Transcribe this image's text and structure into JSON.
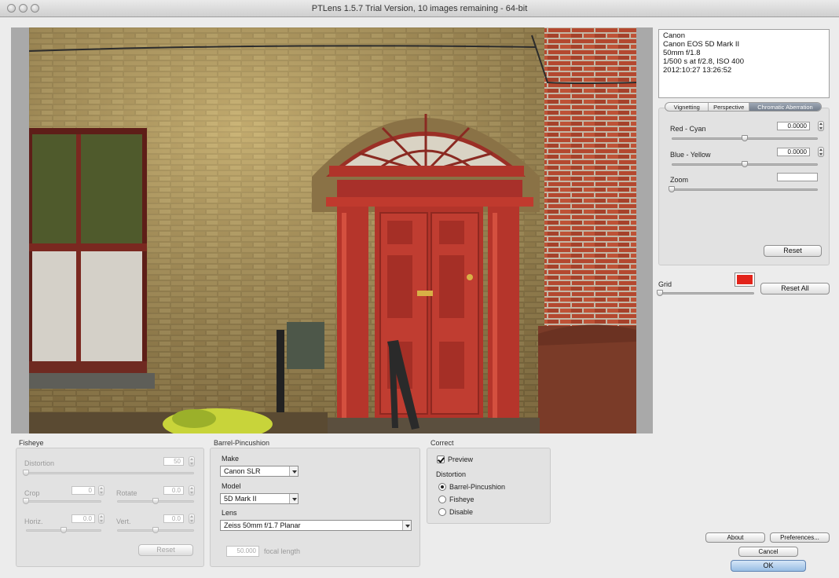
{
  "window": {
    "title": "PTLens 1.5.7 Trial Version, 10 images remaining - 64-bit"
  },
  "exif": {
    "lines": [
      "Canon",
      "Canon EOS 5D Mark II",
      "50mm f/1.8",
      "1/500 s at f/2.8, ISO 400",
      "2012:10:27 13:26:52"
    ]
  },
  "tabs": {
    "vignetting": "Vignetting",
    "perspective": "Perspective",
    "chromatic": "Chromatic Aberration"
  },
  "chromatic_panel": {
    "red_cyan": {
      "label": "Red - Cyan",
      "value": "0.0000",
      "level": 0.5
    },
    "blue_yellow": {
      "label": "Blue - Yellow",
      "value": "0.0000",
      "level": 0.5
    },
    "zoom": {
      "label": "Zoom",
      "value": "",
      "level": 0.0
    },
    "reset": "Reset"
  },
  "grid": {
    "label": "Grid",
    "level": 0.0,
    "color": "#e2231a"
  },
  "reset_all": "Reset All",
  "fisheye": {
    "heading": "Fisheye",
    "distortion": {
      "label": "Distortion",
      "value": "50",
      "level": 0.0
    },
    "crop": {
      "label": "Crop",
      "value": "0",
      "level": 0.0
    },
    "rotate": {
      "label": "Rotate",
      "value": "0.0",
      "level": 0.5
    },
    "horiz": {
      "label": "Horiz.",
      "value": "0.0",
      "level": 0.5
    },
    "vert": {
      "label": "Vert.",
      "value": "0.0",
      "level": 0.5
    },
    "reset": "Reset"
  },
  "barrel": {
    "heading": "Barrel-Pincushion",
    "make_label": "Make",
    "make_value": "Canon SLR",
    "model_label": "Model",
    "model_value": "5D Mark II",
    "lens_label": "Lens",
    "lens_value": "Zeiss 50mm f/1.7 Planar",
    "focal_value": "50.000",
    "focal_label": "focal length"
  },
  "correct": {
    "heading": "Correct",
    "preview": "Preview",
    "distortion_label": "Distortion",
    "options": [
      "Barrel-Pincushion",
      "Fisheye",
      "Disable"
    ],
    "selected": "Barrel-Pincushion"
  },
  "buttons": {
    "about": "About",
    "preferences": "Preferences...",
    "cancel": "Cancel",
    "ok": "OK"
  }
}
